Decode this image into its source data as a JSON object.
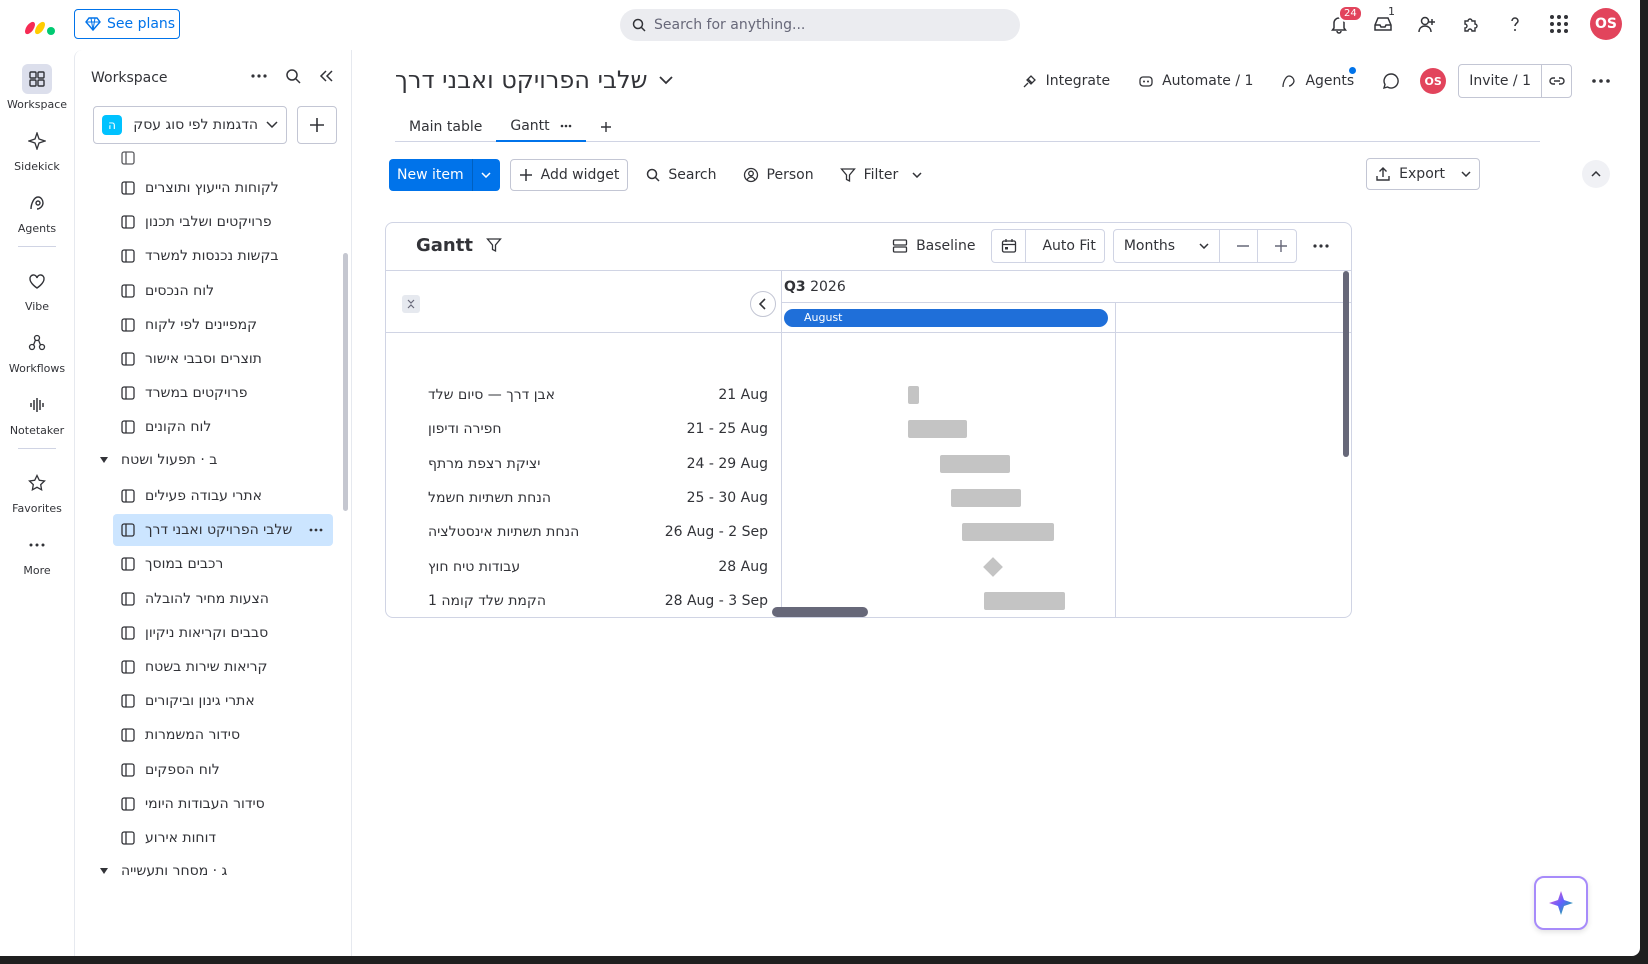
{
  "topbar": {
    "see_plans": "See plans",
    "search_placeholder": "Search for anything...",
    "notifications_count": "24",
    "inbox_count": "1",
    "avatar": "OS"
  },
  "rail": [
    {
      "label": "Workspace",
      "icon": "grid-icon"
    },
    {
      "label": "Sidekick",
      "icon": "sparkle-icon"
    },
    {
      "label": "Agents",
      "icon": "agents-icon"
    },
    {
      "label": "Vibe",
      "icon": "heart-icon"
    },
    {
      "label": "Workflows",
      "icon": "workflows-icon"
    },
    {
      "label": "Notetaker",
      "icon": "waveform-icon"
    },
    {
      "label": "Favorites",
      "icon": "star-icon"
    },
    {
      "label": "More",
      "icon": "more-icon"
    }
  ],
  "sidebar": {
    "title": "Workspace",
    "workspace_name": "הדגמות לפי סוג עסק",
    "workspace_initial": "ה",
    "items": [
      {
        "label": "לקוחות הייעוץ ותוצרים"
      },
      {
        "label": "פרויקטים ושלבי תכנון"
      },
      {
        "label": "בקשות נכנסות למשרד"
      },
      {
        "label": "לוח הנכסים"
      },
      {
        "label": "קמפיינים לפי לקוח"
      },
      {
        "label": "תוצרים וסבבי אישור"
      },
      {
        "label": "פרויקטים במשרד"
      },
      {
        "label": "לוח הקונים"
      }
    ],
    "group_b": "ב · תפעול ושטח",
    "items_b": [
      {
        "label": "אתרי עבודה פעילים"
      },
      {
        "label": "שלבי הפרויקט ואבני דרך"
      },
      {
        "label": "רכבים במוסך"
      },
      {
        "label": "הצעות מחיר להובלה"
      },
      {
        "label": "סבבים וקריאות ניקיון"
      },
      {
        "label": "קריאות שירות בשטח"
      },
      {
        "label": "אתרי גינון וביקורים"
      },
      {
        "label": "סידור המשמרות"
      },
      {
        "label": "לוח הספקים"
      },
      {
        "label": "סידור העבודות היומי"
      },
      {
        "label": "דוחות אירוע"
      }
    ],
    "group_c": "ג · מסחר ותעשייה"
  },
  "board": {
    "title": "שלבי הפרויקט ואבני דרך",
    "integrate": "Integrate",
    "automate": "Automate / 1",
    "agents": "Agents",
    "invite": "Invite / 1",
    "tabs": [
      {
        "label": "Main table"
      },
      {
        "label": "Gantt"
      }
    ],
    "new_item": "New item",
    "add_widget": "Add widget",
    "search": "Search",
    "person": "Person",
    "filter": "Filter",
    "export": "Export"
  },
  "gantt": {
    "title": "Gantt",
    "baseline": "Baseline",
    "auto_fit": "Auto Fit",
    "scale": "Months",
    "quarter_prefix": "Q3",
    "quarter_year": "2026",
    "month": "August",
    "rows": [
      {
        "name": "אבן דרך — סיום שלד",
        "dates": "21 Aug",
        "start": 21,
        "end": 21,
        "type": "milestone-bar"
      },
      {
        "name": "חפירה ודיפון",
        "dates": "21 - 25 Aug",
        "start": 21,
        "end": 25,
        "type": "bar"
      },
      {
        "name": "יציקת רצפת מרתף",
        "dates": "24 - 29 Aug",
        "start": 24,
        "end": 29,
        "type": "bar"
      },
      {
        "name": "הנחת תשתיות חשמל",
        "dates": "25 - 30 Aug",
        "start": 25,
        "end": 30,
        "type": "bar"
      },
      {
        "name": "הנחת תשתיות אינסטלציה",
        "dates": "26 Aug - 2 Sep",
        "start": 26,
        "end": 33,
        "type": "bar"
      },
      {
        "name": "עבודות טיח חוץ",
        "dates": "28 Aug",
        "start": 28,
        "end": 28,
        "type": "milestone"
      },
      {
        "name": "הקמת שלד קומה 1",
        "dates": "28 Aug - 3 Sep",
        "start": 28,
        "end": 34,
        "type": "bar"
      }
    ]
  }
}
